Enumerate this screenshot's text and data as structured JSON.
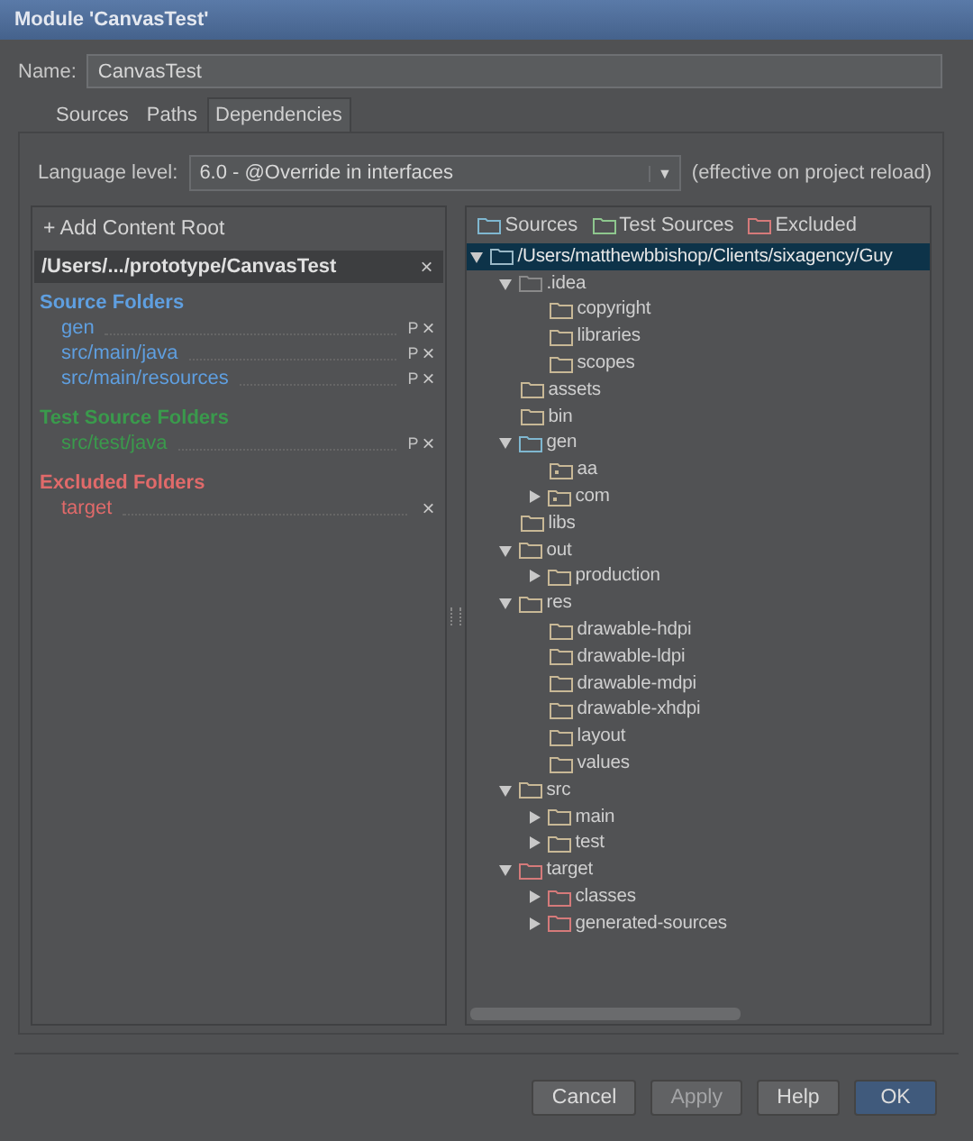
{
  "window": {
    "title": "Module 'CanvasTest'"
  },
  "name_field": {
    "label": "Name:",
    "value": "CanvasTest"
  },
  "tabs": [
    {
      "label": "Sources",
      "selected": false
    },
    {
      "label": "Paths",
      "selected": false
    },
    {
      "label": "Dependencies",
      "selected": true
    }
  ],
  "language_level": {
    "label": "Language level:",
    "value": "6.0 - @Override in interfaces",
    "arrow": "▼",
    "note": "(effective on project reload)"
  },
  "content_roots": {
    "add_label": "+ Add Content Root",
    "root": {
      "path": "/Users/.../prototype/CanvasTest",
      "close": "×"
    },
    "sections": [
      {
        "kind": "source",
        "title": "Source Folders",
        "items": [
          {
            "path": "gen",
            "prefix_mark": "P",
            "close": "×"
          },
          {
            "path": "src/main/java",
            "prefix_mark": "P",
            "close": "×"
          },
          {
            "path": "src/main/resources",
            "prefix_mark": "P",
            "close": "×"
          }
        ]
      },
      {
        "kind": "test",
        "title": "Test Source Folders",
        "items": [
          {
            "path": "src/test/java",
            "prefix_mark": "P",
            "close": "×"
          }
        ]
      },
      {
        "kind": "excluded",
        "title": "Excluded Folders",
        "items": [
          {
            "path": "target",
            "close": "×"
          }
        ]
      }
    ]
  },
  "legend": [
    {
      "kind": "source",
      "label": "Sources"
    },
    {
      "kind": "test",
      "label": "Test Sources"
    },
    {
      "kind": "excluded",
      "label": "Excluded"
    }
  ],
  "tree": [
    {
      "label": "/Users/matthewbbishop/Clients/sixagency/Guy",
      "kind": "root",
      "selected": true,
      "expanded": true,
      "children": [
        {
          "label": ".idea",
          "kind": "dim",
          "selected": false,
          "expanded": true,
          "children": [
            {
              "label": "copyright",
              "kind": "folder",
              "selected": false
            },
            {
              "label": "libraries",
              "kind": "folder",
              "selected": false
            },
            {
              "label": "scopes",
              "kind": "folder",
              "selected": false
            }
          ]
        },
        {
          "label": "assets",
          "kind": "folder",
          "selected": false
        },
        {
          "label": "bin",
          "kind": "folder",
          "selected": false
        },
        {
          "label": "gen",
          "kind": "source",
          "selected": false,
          "expanded": true,
          "children": [
            {
              "label": "aa",
              "kind": "package",
              "selected": false
            },
            {
              "label": "com",
              "kind": "package",
              "selected": false,
              "expanded": false
            }
          ]
        },
        {
          "label": "libs",
          "kind": "folder",
          "selected": false
        },
        {
          "label": "out",
          "kind": "folder",
          "selected": false,
          "expanded": true,
          "children": [
            {
              "label": "production",
              "kind": "folder",
              "selected": false,
              "expanded": false
            }
          ]
        },
        {
          "label": "res",
          "kind": "folder",
          "selected": false,
          "expanded": true,
          "children": [
            {
              "label": "drawable-hdpi",
              "kind": "folder",
              "selected": false
            },
            {
              "label": "drawable-ldpi",
              "kind": "folder",
              "selected": false
            },
            {
              "label": "drawable-mdpi",
              "kind": "folder",
              "selected": false
            },
            {
              "label": "drawable-xhdpi",
              "kind": "folder",
              "selected": false
            },
            {
              "label": "layout",
              "kind": "folder",
              "selected": false
            },
            {
              "label": "values",
              "kind": "folder",
              "selected": false
            }
          ]
        },
        {
          "label": "src",
          "kind": "folder",
          "selected": false,
          "expanded": true,
          "children": [
            {
              "label": "main",
              "kind": "folder",
              "selected": false,
              "expanded": false
            },
            {
              "label": "test",
              "kind": "folder",
              "selected": false,
              "expanded": false
            }
          ]
        },
        {
          "label": "target",
          "kind": "excluded",
          "selected": false,
          "expanded": true,
          "children": [
            {
              "label": "classes",
              "kind": "excluded",
              "selected": false,
              "expanded": false
            },
            {
              "label": "generated-sources",
              "kind": "excluded",
              "selected": false,
              "expanded": false
            }
          ]
        }
      ]
    }
  ],
  "buttons": [
    {
      "label": "Cancel",
      "kind": "normal",
      "disabled": false
    },
    {
      "label": "Apply",
      "kind": "normal",
      "disabled": true
    },
    {
      "label": "Help",
      "kind": "normal",
      "disabled": false
    },
    {
      "label": "OK",
      "kind": "default",
      "disabled": false
    }
  ]
}
